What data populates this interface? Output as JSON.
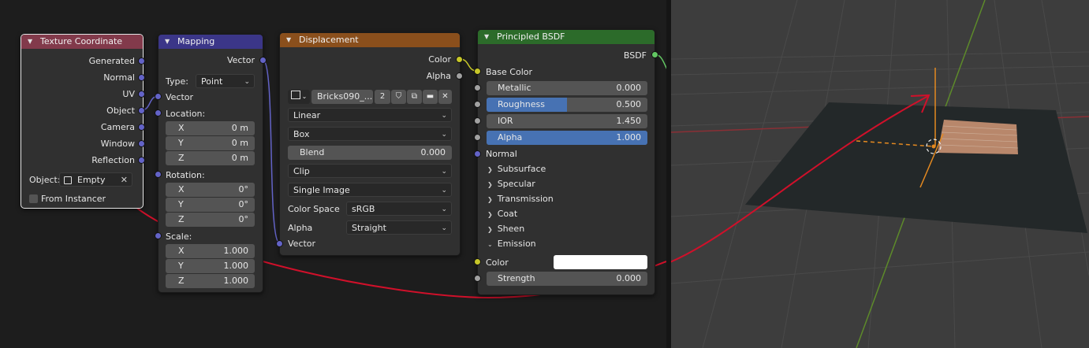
{
  "colors": {
    "wire_vector": "#6363c7",
    "wire_color": "#c7c729",
    "wire_shader": "#63c763",
    "annotation": "#d0102a",
    "empty_axis": "#e58a20"
  },
  "tex_coord": {
    "title": "Texture Coordinate",
    "outputs": [
      "Generated",
      "Normal",
      "UV",
      "Object",
      "Camera",
      "Window",
      "Reflection"
    ],
    "object_label": "Object:",
    "object_value": "Empty",
    "from_instancer": "From Instancer"
  },
  "mapping": {
    "title": "Mapping",
    "output": "Vector",
    "type_label": "Type:",
    "type_value": "Point",
    "vector_in": "Vector",
    "location_label": "Location:",
    "location": [
      {
        "axis": "X",
        "value": "0 m"
      },
      {
        "axis": "Y",
        "value": "0 m"
      },
      {
        "axis": "Z",
        "value": "0 m"
      }
    ],
    "rotation_label": "Rotation:",
    "rotation": [
      {
        "axis": "X",
        "value": "0°"
      },
      {
        "axis": "Y",
        "value": "0°"
      },
      {
        "axis": "Z",
        "value": "0°"
      }
    ],
    "scale_label": "Scale:",
    "scale": [
      {
        "axis": "X",
        "value": "1.000"
      },
      {
        "axis": "Y",
        "value": "1.000"
      },
      {
        "axis": "Z",
        "value": "1.000"
      }
    ]
  },
  "displacement": {
    "title": "Displacement",
    "out_color": "Color",
    "out_alpha": "Alpha",
    "image_name": "Bricks090_...",
    "users": "2",
    "interpolation": "Linear",
    "projection": "Box",
    "blend_label": "Blend",
    "blend_value": "0.000",
    "extension": "Clip",
    "source": "Single Image",
    "color_space_label": "Color Space",
    "color_space_value": "sRGB",
    "alpha_label": "Alpha",
    "alpha_value": "Straight",
    "vector_in": "Vector"
  },
  "bsdf": {
    "title": "Principled BSDF",
    "output": "BSDF",
    "base_color": "Base Color",
    "metallic_label": "Metallic",
    "metallic_value": "0.000",
    "roughness_label": "Roughness",
    "roughness_value": "0.500",
    "roughness_fraction": 0.5,
    "ior_label": "IOR",
    "ior_value": "1.450",
    "alpha_label": "Alpha",
    "alpha_value": "1.000",
    "alpha_fraction": 1.0,
    "normal": "Normal",
    "panels": [
      "Subsurface",
      "Specular",
      "Transmission",
      "Coat",
      "Sheen"
    ],
    "emission": "Emission",
    "emission_color_label": "Color",
    "emission_color": "#ffffff",
    "strength_label": "Strength",
    "strength_value": "0.000"
  }
}
